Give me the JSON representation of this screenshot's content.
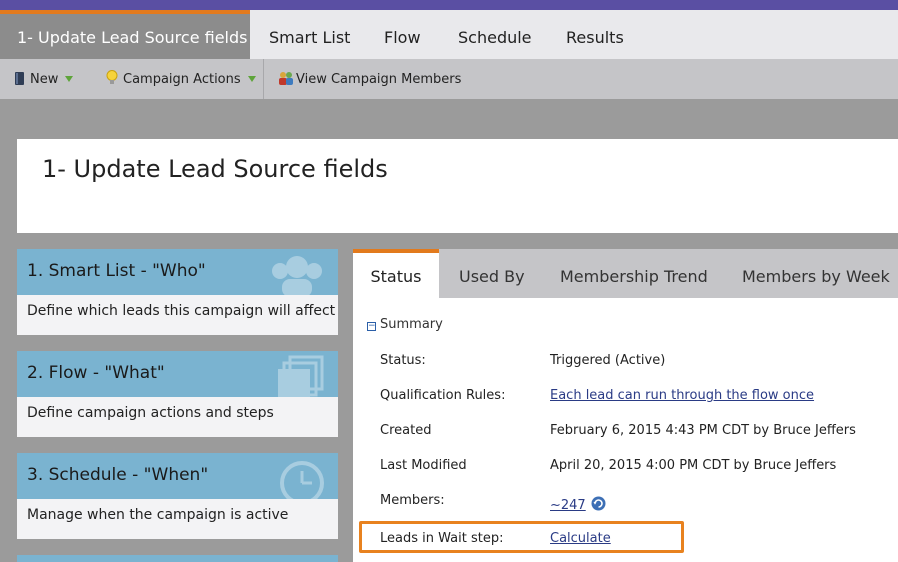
{
  "tabs": {
    "active": "1- Update Lead Source fields",
    "smart_list": "Smart List",
    "flow": "Flow",
    "schedule": "Schedule",
    "results": "Results"
  },
  "toolbar": {
    "new": "New",
    "campaign_actions": "Campaign Actions",
    "view_members": "View Campaign Members"
  },
  "header": {
    "title": "1- Update Lead Source fields"
  },
  "steps": [
    {
      "title": "1. Smart List - \"Who\"",
      "desc": "Define which leads this campaign will affect"
    },
    {
      "title": "2. Flow - \"What\"",
      "desc": "Define campaign actions and steps"
    },
    {
      "title": "3. Schedule - \"When\"",
      "desc": "Manage when the campaign is active"
    }
  ],
  "panel": {
    "tabs": [
      "Status",
      "Used By",
      "Membership Trend",
      "Members by Week"
    ],
    "summary": "Summary",
    "rows": [
      {
        "label": "Status:",
        "value": "Triggered (Active)"
      },
      {
        "label": "Qualification Rules:",
        "value": "Each lead can run through the flow once"
      },
      {
        "label": "Created",
        "value": "February 6, 2015 4:43 PM CDT by Bruce Jeffers"
      },
      {
        "label": "Last Modified",
        "value": "April 20, 2015 4:00 PM CDT by Bruce Jeffers"
      },
      {
        "label": "Members:",
        "value": "~247"
      },
      {
        "label": "Leads in Wait step:",
        "value": "Calculate"
      }
    ]
  },
  "colors": {
    "accent": "#e27a1d",
    "top_bar": "#5a4fa3",
    "step_header": "#7ab3d0"
  }
}
